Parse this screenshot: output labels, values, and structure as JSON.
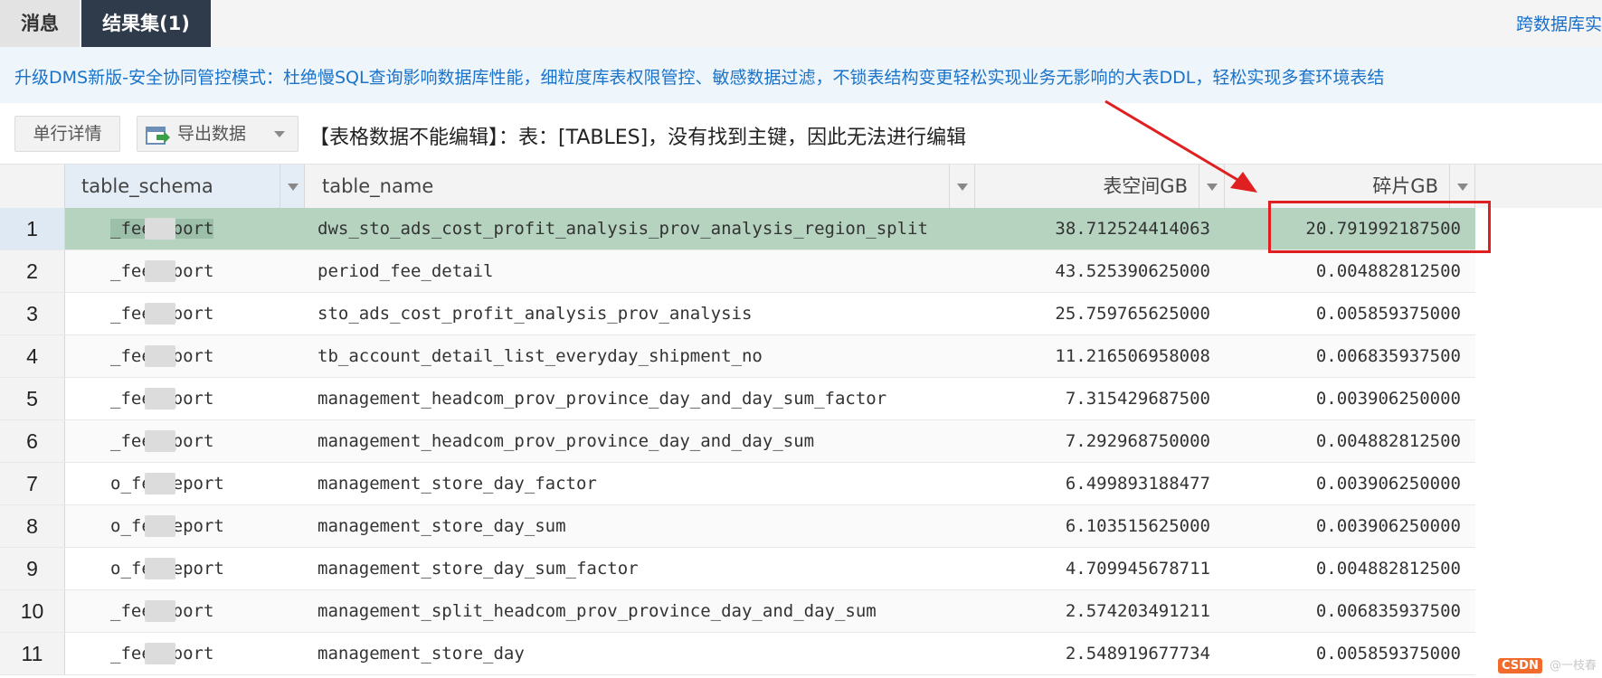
{
  "tabs": {
    "messages_label": "消息",
    "resultset_label": "结果集(1)"
  },
  "crossdb_link": "跨数据库实",
  "banner": {
    "text": "升级DMS新版-安全协同管控模式：杜绝慢SQL查询影响数据库性能，细粒度库表权限管控、敏感数据过滤，不锁表结构变更轻松实现业务无影响的大表DDL，轻松实现多套环境表结"
  },
  "toolbar": {
    "detail_label": "单行详情",
    "export_label": "导出数据",
    "notice": "【表格数据不能编辑】：表：[TABLES]，没有找到主键，因此无法进行编辑"
  },
  "columns": {
    "schema": "table_schema",
    "name": "table_name",
    "space": "表空间GB",
    "frag": "碎片GB"
  },
  "rows": [
    {
      "n": "1",
      "schema": "_feereport",
      "name": "dws_sto_ads_cost_profit_analysis_prov_analysis_region_split",
      "space": "38.712524414063",
      "frag": "20.791992187500"
    },
    {
      "n": "2",
      "schema": "_feereport",
      "name": "period_fee_detail",
      "space": "43.525390625000",
      "frag": "0.004882812500"
    },
    {
      "n": "3",
      "schema": "_feereport",
      "name": "sto_ads_cost_profit_analysis_prov_analysis",
      "space": "25.759765625000",
      "frag": "0.005859375000"
    },
    {
      "n": "4",
      "schema": "_feereport",
      "name": "tb_account_detail_list_everyday_shipment_no",
      "space": "11.216506958008",
      "frag": "0.006835937500"
    },
    {
      "n": "5",
      "schema": "_feereport",
      "name": "management_headcom_prov_province_day_and_day_sum_factor",
      "space": "7.315429687500",
      "frag": "0.003906250000"
    },
    {
      "n": "6",
      "schema": "_feereport",
      "name": "management_headcom_prov_province_day_and_day_sum",
      "space": "7.292968750000",
      "frag": "0.004882812500"
    },
    {
      "n": "7",
      "schema": "o_feereport",
      "name": "management_store_day_factor",
      "space": "6.499893188477",
      "frag": "0.003906250000"
    },
    {
      "n": "8",
      "schema": "o_feereport",
      "name": "management_store_day_sum",
      "space": "6.103515625000",
      "frag": "0.003906250000"
    },
    {
      "n": "9",
      "schema": "o_feereport",
      "name": "management_store_day_sum_factor",
      "space": "4.709945678711",
      "frag": "0.004882812500"
    },
    {
      "n": "10",
      "schema": "_feereport",
      "name": "management_split_headcom_prov_province_day_and_day_sum",
      "space": "2.574203491211",
      "frag": "0.006835937500"
    },
    {
      "n": "11",
      "schema": "_feereport",
      "name": "management_store_day",
      "space": "2.548919677734",
      "frag": "0.005859375000"
    }
  ],
  "watermark": {
    "logo": "CSDN",
    "text": "@一枝春"
  },
  "colors": {
    "accent": "#2f3a4a",
    "link": "#1a73c9",
    "selected_row": "#b5d3bf",
    "annotation": "#e02020"
  }
}
